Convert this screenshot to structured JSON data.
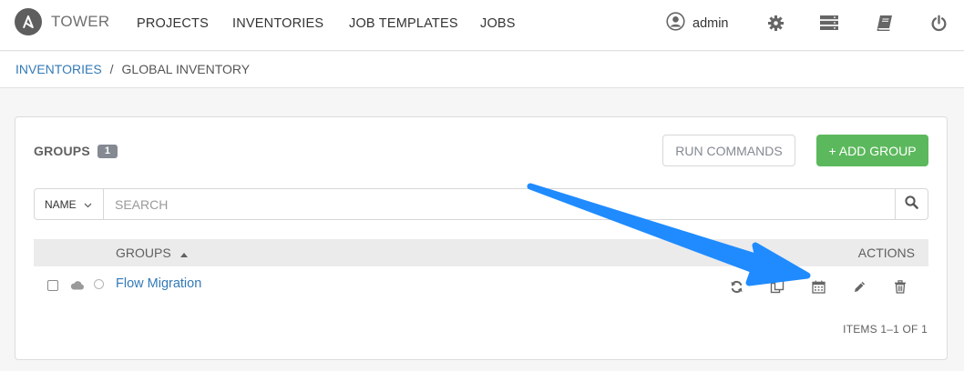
{
  "brand": {
    "name": "TOWER",
    "logo_icon": "ansible-logo-icon"
  },
  "nav": {
    "links": [
      "PROJECTS",
      "INVENTORIES",
      "JOB TEMPLATES",
      "JOBS"
    ],
    "user": "admin",
    "icons": [
      "user-icon",
      "gear-icon",
      "server-icon",
      "book-icon",
      "power-icon"
    ]
  },
  "breadcrumb": {
    "parent": "INVENTORIES",
    "separator": "/",
    "current": "GLOBAL INVENTORY"
  },
  "panel": {
    "title": "GROUPS",
    "count": "1",
    "run_commands_label": "RUN COMMANDS",
    "add_group_label": "+ ADD GROUP"
  },
  "search": {
    "key": "NAME",
    "placeholder": "SEARCH"
  },
  "table": {
    "headers": {
      "groups": "GROUPS",
      "actions": "ACTIONS"
    },
    "rows": [
      {
        "name": "Flow Migration",
        "actions": [
          "sync-icon",
          "copy-icon",
          "calendar-icon",
          "pencil-icon",
          "trash-icon"
        ]
      }
    ]
  },
  "pager": {
    "text": "ITEMS 1–1 OF 1"
  },
  "colors": {
    "primary": "#337ab7",
    "success": "#5cb85c",
    "arrow": "#1f8bff"
  }
}
